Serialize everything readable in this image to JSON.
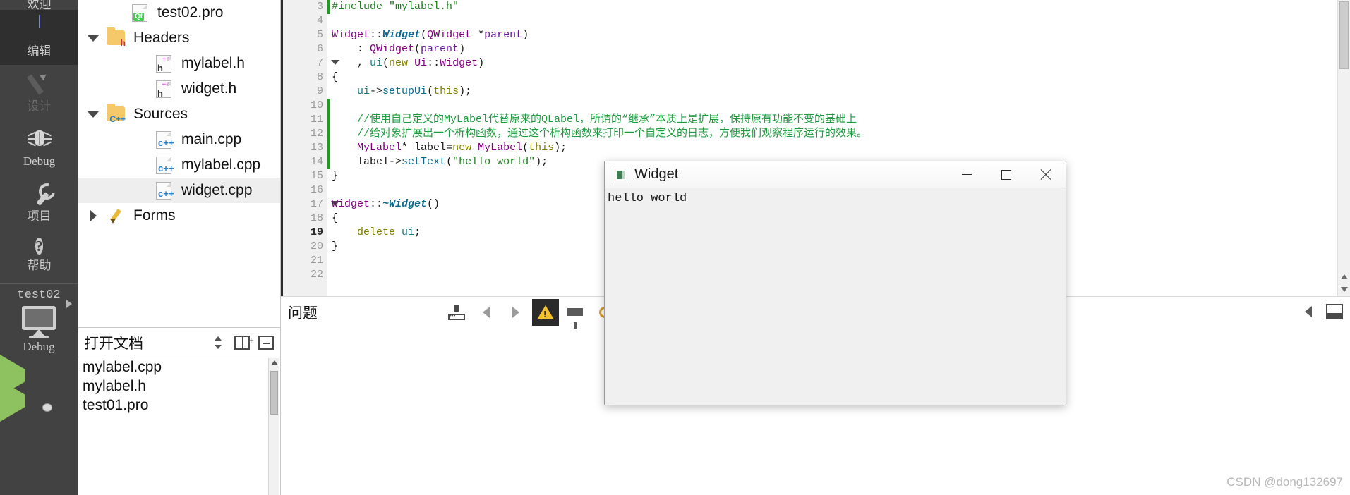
{
  "modebar": {
    "welcome_label": "欢迎",
    "items": [
      {
        "label": "编辑",
        "icon": "document-lines-icon",
        "state": "active"
      },
      {
        "label": "设计",
        "icon": "pencil-icon",
        "state": "disabled"
      },
      {
        "label": "Debug",
        "icon": "bug-icon",
        "state": "normal"
      },
      {
        "label": "项目",
        "icon": "wrench-icon",
        "state": "normal"
      },
      {
        "label": "帮助",
        "icon": "question-circle-icon",
        "state": "normal"
      }
    ],
    "help_glyph": "?",
    "kit": {
      "project_name": "test02",
      "build_config": "Debug",
      "monitor_icon": "monitor-icon",
      "expand_icon": "right-caret-icon"
    },
    "run_button_icon": "run-triangle-icon",
    "debug_button_icon": "run-debug-triangle-icon"
  },
  "project_tree": {
    "rows": [
      {
        "indent": 2,
        "arrow": "none",
        "icon": "qt-pro-file-icon",
        "label": "test02.pro",
        "selected": false
      },
      {
        "indent": 1,
        "arrow": "expanded",
        "icon": "folder-headers-icon",
        "label": "Headers",
        "selected": false
      },
      {
        "indent": 3,
        "arrow": "none",
        "icon": "h-file-icon",
        "label": "mylabel.h",
        "selected": false
      },
      {
        "indent": 3,
        "arrow": "none",
        "icon": "h-file-icon",
        "label": "widget.h",
        "selected": false
      },
      {
        "indent": 1,
        "arrow": "expanded",
        "icon": "folder-sources-icon",
        "label": "Sources",
        "selected": false
      },
      {
        "indent": 3,
        "arrow": "none",
        "icon": "cpp-file-icon",
        "label": "main.cpp",
        "selected": false
      },
      {
        "indent": 3,
        "arrow": "none",
        "icon": "cpp-file-icon",
        "label": "mylabel.cpp",
        "selected": false
      },
      {
        "indent": 3,
        "arrow": "none",
        "icon": "cpp-file-icon",
        "label": "widget.cpp",
        "selected": true
      },
      {
        "indent": 1,
        "arrow": "collapsed",
        "icon": "folder-forms-icon",
        "label": "Forms",
        "selected": false
      }
    ]
  },
  "open_documents": {
    "title": "打开文档",
    "buttons": [
      {
        "name": "sort-updown-button",
        "icon": "up-down-arrows-icon"
      },
      {
        "name": "split-editor-button",
        "icon": "split-plus-icon"
      },
      {
        "name": "close-split-button",
        "icon": "close-split-icon"
      }
    ],
    "items": [
      {
        "label": "mylabel.cpp"
      },
      {
        "label": "mylabel.h"
      },
      {
        "label": "test01.pro"
      }
    ]
  },
  "editor": {
    "first_visible_line": 3,
    "current_line": 19,
    "lines": [
      {
        "n": 3,
        "fold": false,
        "changed": true,
        "text": "#include \"mylabel.h\""
      },
      {
        "n": 4,
        "fold": false,
        "changed": false,
        "text": ""
      },
      {
        "n": 5,
        "fold": false,
        "changed": false,
        "text": "Widget::Widget(QWidget *parent)"
      },
      {
        "n": 6,
        "fold": false,
        "changed": false,
        "text": "    : QWidget(parent)"
      },
      {
        "n": 7,
        "fold": true,
        "changed": false,
        "text": "    , ui(new Ui::Widget)"
      },
      {
        "n": 8,
        "fold": false,
        "changed": false,
        "text": "{"
      },
      {
        "n": 9,
        "fold": false,
        "changed": false,
        "text": "    ui->setupUi(this);"
      },
      {
        "n": 10,
        "fold": false,
        "changed": true,
        "text": ""
      },
      {
        "n": 11,
        "fold": false,
        "changed": true,
        "text": "    //使用自己定义的MyLabel代替原来的QLabel，所谓的“继承”本质上是扩展，保持原有功能不变的基础上"
      },
      {
        "n": 12,
        "fold": false,
        "changed": true,
        "text": "    //给对象扩展出一个析构函数，通过这个析构函数来打印一个自定义的日志，方便我们观察程序运行的效果。"
      },
      {
        "n": 13,
        "fold": false,
        "changed": true,
        "text": "    MyLabel* label=new MyLabel(this);"
      },
      {
        "n": 14,
        "fold": false,
        "changed": true,
        "text": "    label->setText(\"hello world\");"
      },
      {
        "n": 15,
        "fold": false,
        "changed": false,
        "text": "}"
      },
      {
        "n": 16,
        "fold": false,
        "changed": false,
        "text": ""
      },
      {
        "n": 17,
        "fold": true,
        "changed": false,
        "text": "Widget::~Widget()"
      },
      {
        "n": 18,
        "fold": false,
        "changed": false,
        "text": "{"
      },
      {
        "n": 19,
        "fold": false,
        "changed": false,
        "text": "    delete ui;"
      },
      {
        "n": 20,
        "fold": false,
        "changed": false,
        "text": "}"
      },
      {
        "n": 21,
        "fold": false,
        "changed": false,
        "text": ""
      },
      {
        "n": 22,
        "fold": false,
        "changed": false,
        "text": ""
      }
    ]
  },
  "panel_bar": {
    "title": "问题",
    "tools": [
      {
        "name": "output-filter-icon",
        "icon": "output-icon",
        "selected": false
      },
      {
        "name": "prev-item-button",
        "icon": "chevron-left-icon",
        "selected": false
      },
      {
        "name": "next-item-button",
        "icon": "chevron-right-icon",
        "selected": false
      },
      {
        "name": "warnings-toggle",
        "icon": "warning-triangle-icon",
        "selected": true
      },
      {
        "name": "filter-button",
        "icon": "funnel-icon",
        "selected": false
      },
      {
        "name": "search-button",
        "icon": "magnifier-icon",
        "selected": false
      }
    ],
    "right_tools": [
      {
        "name": "expand-panel-button",
        "icon": "left-caret-icon"
      },
      {
        "name": "maximize-panel-button",
        "icon": "panel-box-icon"
      }
    ]
  },
  "dialog": {
    "title": "Widget",
    "icon": "qt-widget-icon",
    "body_text": "hello world",
    "controls": [
      {
        "name": "minimize-button",
        "icon": "minimize-icon"
      },
      {
        "name": "maximize-button",
        "icon": "maximize-icon"
      },
      {
        "name": "close-button",
        "icon": "close-icon"
      }
    ]
  },
  "watermark": {
    "text": "CSDN @dong132697"
  },
  "colors": {
    "modebar_bg": "#424242",
    "mode_active_bg": "#2f2f2f",
    "accent_green": "#8ec160",
    "comment_green": "#1f9b3f",
    "selection_gray": "#eeeeee",
    "warning_yellow": "#f2c12e"
  }
}
